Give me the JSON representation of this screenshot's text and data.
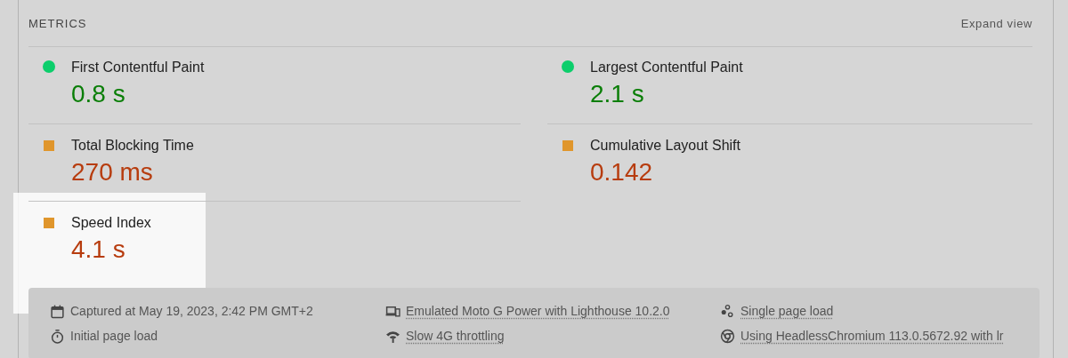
{
  "section": {
    "title": "METRICS",
    "action": "Expand view"
  },
  "metrics": [
    {
      "label": "First Contentful Paint",
      "value": "0.8 s",
      "kind": "circle",
      "color": "#0cce6b"
    },
    {
      "label": "Largest Contentful Paint",
      "value": "2.1 s",
      "kind": "circle",
      "color": "#0cce6b"
    },
    {
      "label": "Total Blocking Time",
      "value": "270 ms",
      "kind": "square",
      "color": "#e0962c"
    },
    {
      "label": "Cumulative Layout Shift",
      "value": "0.142",
      "kind": "square",
      "color": "#e0962c"
    },
    {
      "label": "Speed Index",
      "value": "4.1 s",
      "kind": "square",
      "color": "#e0962c"
    }
  ],
  "highlight": {
    "kind": "spotlight"
  },
  "runtime": [
    {
      "text": "Captured at May 19, 2023, 2:42 PM GMT+2",
      "link": false
    },
    {
      "text": "Emulated Moto G Power with Lighthouse 10.2.0",
      "link": true
    },
    {
      "text": "Single page load",
      "link": true
    },
    {
      "text": "Initial page load",
      "link": false
    },
    {
      "text": "Slow 4G throttling",
      "link": true
    },
    {
      "text": "Using HeadlessChromium 113.0.5672.92 with lr",
      "link": true
    }
  ]
}
